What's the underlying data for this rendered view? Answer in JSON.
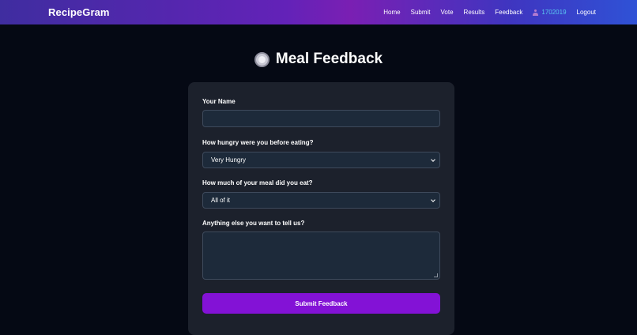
{
  "header": {
    "brand": "RecipeGram",
    "nav": [
      {
        "label": "Home"
      },
      {
        "label": "Submit"
      },
      {
        "label": "Vote"
      },
      {
        "label": "Results"
      },
      {
        "label": "Feedback"
      }
    ],
    "user": {
      "icon": "user-icon",
      "name": "1702019"
    },
    "logout_label": "Logout"
  },
  "page": {
    "icon": "plate-icon",
    "title": "Meal Feedback"
  },
  "form": {
    "name_label": "Your Name",
    "name_value": "",
    "hunger_label": "How hungry were you before eating?",
    "hunger_selected": "Very Hungry",
    "eaten_label": "How much of your meal did you eat?",
    "eaten_selected": "All of it",
    "comments_label": "Anything else you want to tell us?",
    "comments_value": "",
    "submit_label": "Submit Feedback"
  },
  "colors": {
    "accent": "#8312d6",
    "background": "#050914",
    "card": "#1c212c",
    "user_link": "#5ac8f0"
  }
}
